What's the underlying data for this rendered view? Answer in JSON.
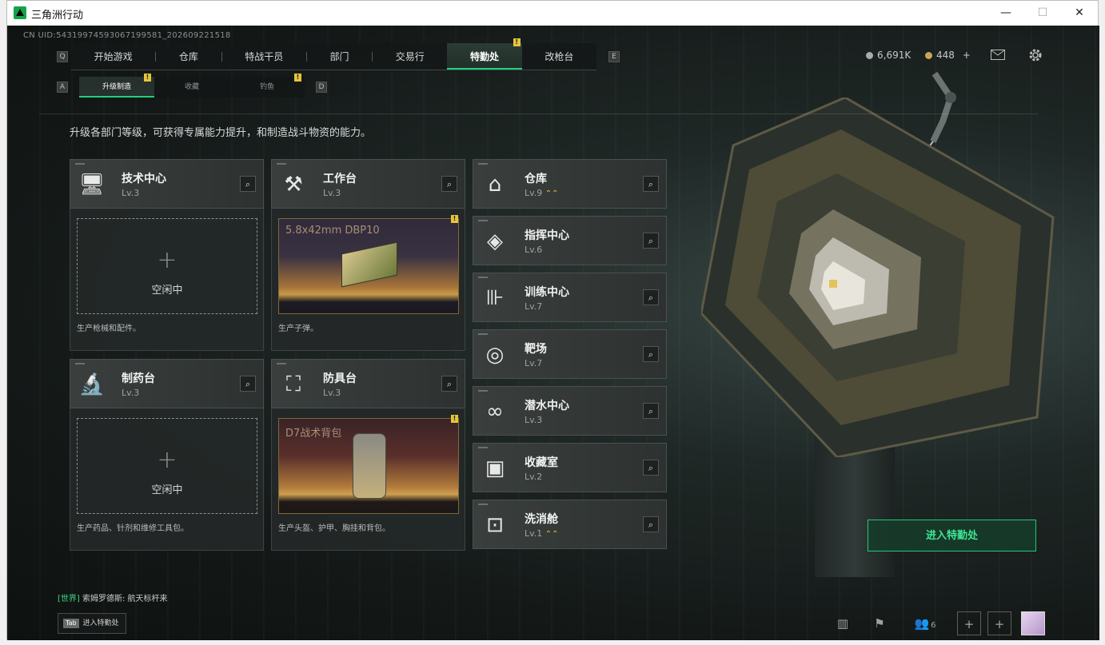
{
  "window": {
    "title": "三角洲行动",
    "minimize": "—",
    "maximize": "☐",
    "close": "✕"
  },
  "uid": "CN UID:5431997459306719958­1_202609221518",
  "keys": {
    "q": "Q",
    "e": "E",
    "a": "A",
    "d": "D"
  },
  "top_nav": {
    "tabs": [
      {
        "label": "开始游戏"
      },
      {
        "label": "仓库"
      },
      {
        "label": "特战干员"
      },
      {
        "label": "部门"
      },
      {
        "label": "交易行"
      },
      {
        "label": "特勤处",
        "active": true,
        "badge": "!"
      },
      {
        "label": "改枪台"
      }
    ]
  },
  "currency": {
    "silver": "6,691K",
    "gold": "448",
    "add": "+"
  },
  "sub_nav": {
    "tabs": [
      {
        "label": "升级制造",
        "active": true,
        "badge": "!"
      },
      {
        "label": "收藏"
      },
      {
        "label": "钓鱼",
        "badge": "!"
      }
    ]
  },
  "description": "升级各部门等级，可获得专属能力提升，和制造战斗物资的能力。",
  "workshops": [
    {
      "name": "技术中心",
      "level": "Lv.3",
      "status": "空闲中",
      "footer": "生产枪械和配件。"
    },
    {
      "name": "工作台",
      "level": "Lv.3",
      "product": "5.8x42mm DBP10",
      "badge": "!",
      "footer": "生产子弹。"
    },
    {
      "name": "制药台",
      "level": "Lv.3",
      "status": "空闲中",
      "footer": "生产药品、针剂和维修工具包。"
    },
    {
      "name": "防具台",
      "level": "Lv.3",
      "product": "D7战术背包",
      "badge": "!",
      "footer": "生产头盔、护甲、胸挂和背包。"
    }
  ],
  "rooms": [
    {
      "name": "仓库",
      "level": "Lv.9",
      "upgrade": "⌃⌃"
    },
    {
      "name": "指挥中心",
      "level": "Lv.6"
    },
    {
      "name": "训练中心",
      "level": "Lv.7"
    },
    {
      "name": "靶场",
      "level": "Lv.7"
    },
    {
      "name": "潜水中心",
      "level": "Lv.3"
    },
    {
      "name": "收藏室",
      "level": "Lv.2"
    },
    {
      "name": "洗消舱",
      "level": "Lv.1",
      "upgrade": "⌃⌃"
    }
  ],
  "enter_button": "进入特勤处",
  "chat": {
    "channel": "[世界]",
    "message": "索姆罗德斯: 航天标杆来"
  },
  "tab_hint": {
    "key": "Tab",
    "label": "进入特勤处"
  },
  "bottom": {
    "friends_count": "6",
    "add1": "+",
    "add2": "+"
  },
  "search_glyph": "⌕"
}
